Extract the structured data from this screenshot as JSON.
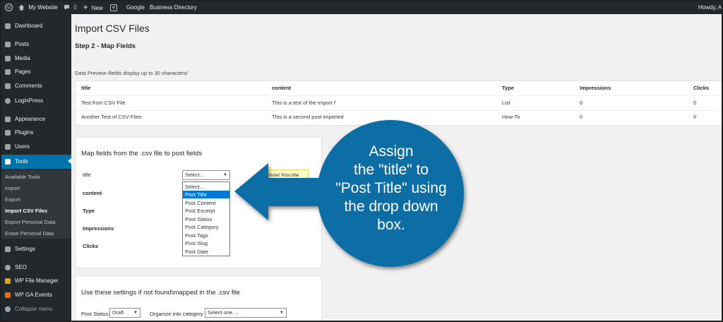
{
  "admin_bar": {
    "site_name": "My Website",
    "comments_count": "0",
    "new_label": "New",
    "google_label": "Google",
    "directory_label": "Business Directory",
    "greeting": "Howdy, A"
  },
  "sidebar": {
    "items": [
      {
        "label": "Dashboard",
        "icon": "dashboard-icon"
      },
      {
        "label": "Posts",
        "icon": "pin-icon"
      },
      {
        "label": "Media",
        "icon": "media-icon"
      },
      {
        "label": "Pages",
        "icon": "pages-icon"
      },
      {
        "label": "Comments",
        "icon": "comment-icon"
      },
      {
        "label": "LoginPress",
        "icon": "gear-icon"
      },
      {
        "label": "Appearance",
        "icon": "brush-icon"
      },
      {
        "label": "Plugins",
        "icon": "plug-icon"
      },
      {
        "label": "Users",
        "icon": "users-icon"
      },
      {
        "label": "Tools",
        "icon": "wrench-icon"
      },
      {
        "label": "Settings",
        "icon": "settings-icon"
      },
      {
        "label": "SEO",
        "icon": "seo-icon"
      },
      {
        "label": "WP File Manager",
        "icon": "folder-icon"
      },
      {
        "label": "WP GA Events",
        "icon": "chart-icon"
      },
      {
        "label": "Collapse menu",
        "icon": "collapse-icon"
      }
    ],
    "submenu": [
      "Available Tools",
      "Import",
      "Export",
      "Import CSV Files",
      "Export Personal Data",
      "Erase Personal Data"
    ]
  },
  "main": {
    "title": "Import CSV Files",
    "step": "Step 2 - Map Fields",
    "preview_label": "Data Preview /fields display up to 30 characters/",
    "table": {
      "headers": [
        "title",
        "content",
        "Type",
        "Impressions",
        "Clicks"
      ],
      "rows": [
        [
          "Test from CSV File",
          "This is a test of the import f",
          "List",
          "0",
          "0"
        ],
        [
          "Another Test of CSV Files",
          "This is a second post imported",
          "How-To",
          "0",
          "0"
        ]
      ]
    },
    "map_card": {
      "title": "Map fields from the .csv file to post fields",
      "fields": [
        "title",
        "content",
        "Type",
        "Impressions",
        "Clicks"
      ],
      "select_value": "Select...",
      "options": [
        "Select...",
        "Post Title",
        "Post Content",
        "Post Excerpt",
        "Post Status",
        "Post Category",
        "Post Tags",
        "Post Slug",
        "Post Date"
      ],
      "note": "Note! Post title"
    },
    "settings_card": {
      "title": "Use these settings if not found\\mapped in the .csv file",
      "status_label": "Post Status:",
      "status_value": "Draft",
      "category_label": "Organize into category",
      "category_value": "Select one ..."
    }
  },
  "callout": {
    "lines": [
      "Assign",
      "the \"title\" to",
      "\"Post Title\" using",
      "the drop down",
      "box."
    ],
    "color": "#0b6ea6"
  }
}
